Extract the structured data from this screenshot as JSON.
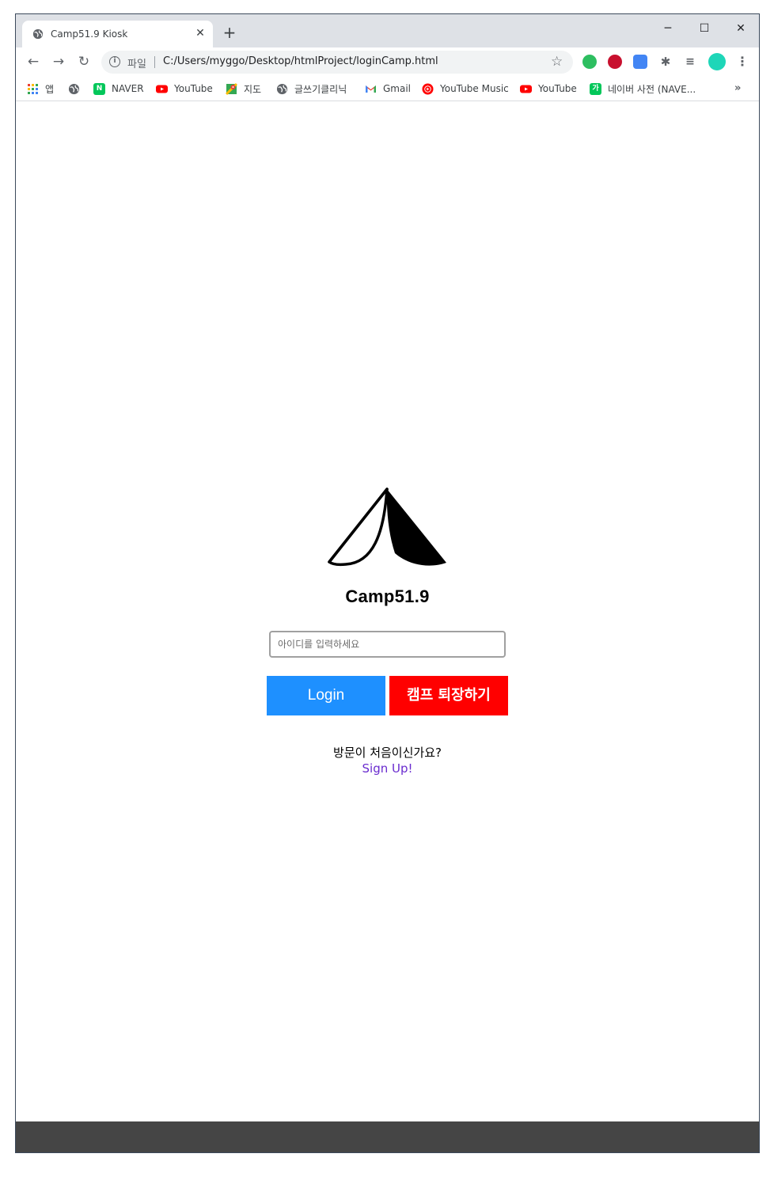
{
  "browser": {
    "tab": {
      "title": "Camp51.9 Kiosk",
      "favicon": "globe-icon",
      "close": "✕"
    },
    "new_tab": "+",
    "window_controls": {
      "minimize": "─",
      "maximize": "☐",
      "close": "✕"
    },
    "nav": {
      "back": "←",
      "forward": "→",
      "reload": "↻"
    },
    "omnibox": {
      "info": "i",
      "scheme_label": "파일",
      "url": "C:/Users/myggo/Desktop/htmlProject/loginCamp.html",
      "star": "☆"
    },
    "menu": "⋮"
  },
  "bookmarks": [
    {
      "label": "앱",
      "icon": "apps-grid-icon"
    },
    {
      "label": "",
      "icon": "globe-icon"
    },
    {
      "label": "NAVER",
      "icon": "naver-icon",
      "badge": "N"
    },
    {
      "label": "YouTube",
      "icon": "youtube-icon"
    },
    {
      "label": "지도",
      "icon": "maps-icon"
    },
    {
      "label": "글쓰기클리닉",
      "icon": "globe-icon"
    },
    {
      "label": "Gmail",
      "icon": "gmail-icon",
      "badge": "M"
    },
    {
      "label": "YouTube Music",
      "icon": "youtube-music-icon"
    },
    {
      "label": "YouTube",
      "icon": "youtube-icon"
    },
    {
      "label": "네이버 사전 (NAVE...",
      "icon": "naver-dict-icon",
      "badge": "가"
    }
  ],
  "bookmarks_more": "»",
  "colors": {
    "login_button": "#1e90ff",
    "exit_button": "#ff0000",
    "signup_link": "#6a2ccf",
    "footer": "#454545"
  },
  "login": {
    "brand": "Camp51.9",
    "id_placeholder": "아이디를 입력하세요",
    "login_button": "Login",
    "exit_button": "캠프 퇴장하기",
    "first_visit_text": "방문이 처음이신가요?",
    "signup_link": "Sign Up!"
  }
}
